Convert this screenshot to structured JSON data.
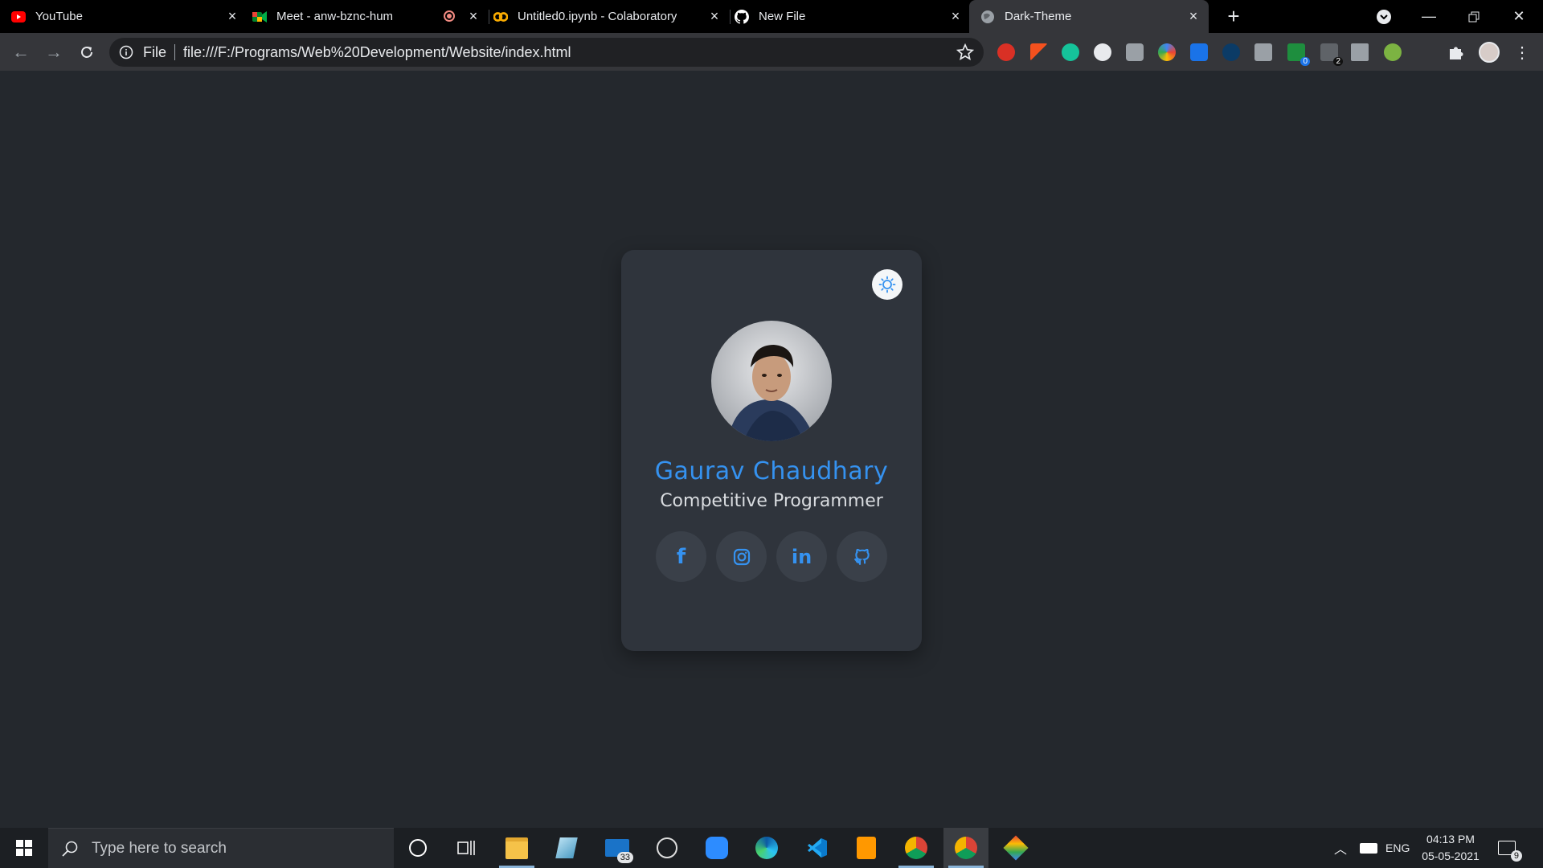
{
  "browser": {
    "tabs": [
      {
        "label": "YouTube",
        "icon": "youtube-icon"
      },
      {
        "label": "Meet - anw-bznc-hum",
        "icon": "meet-icon"
      },
      {
        "label": "Untitled0.ipynb - Colaboratory",
        "icon": "colab-icon"
      },
      {
        "label": "New File",
        "icon": "github-icon"
      },
      {
        "label": "Dark-Theme",
        "icon": "globe-icon",
        "active": true
      }
    ],
    "address": {
      "scheme": "File",
      "url": "file:///F:/Programs/Web%20Development/Website/index.html"
    },
    "extension_badges": [
      "0",
      "2"
    ]
  },
  "profile_card": {
    "name": "Gaurav Chaudhary",
    "role": "Competitive Programmer",
    "socials": [
      {
        "icon": "facebook-icon",
        "glyph": "f"
      },
      {
        "icon": "instagram-icon",
        "glyph": ""
      },
      {
        "icon": "linkedin-icon",
        "glyph": "in"
      },
      {
        "icon": "github-icon",
        "glyph": ""
      }
    ],
    "colors": {
      "accent": "#3592f0",
      "card": "#2f343c",
      "page": "#24282d"
    }
  },
  "taskbar": {
    "search_placeholder": "Type here to search",
    "mail_badge": "33",
    "notif_badge": "9",
    "language": "ENG",
    "time": "04:13 PM",
    "date": "05-05-2021"
  }
}
